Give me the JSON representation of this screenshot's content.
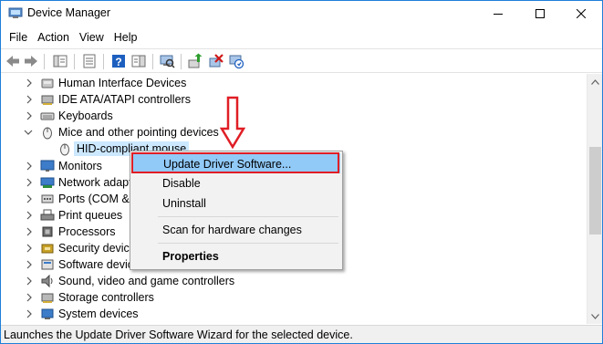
{
  "window": {
    "title": "Device Manager"
  },
  "menubar": [
    "File",
    "Action",
    "View",
    "Help"
  ],
  "tree": [
    {
      "label": "Human Interface Devices",
      "expanded": false,
      "icon": "hid-icon"
    },
    {
      "label": "IDE ATA/ATAPI controllers",
      "expanded": false,
      "icon": "ide-controller-icon"
    },
    {
      "label": "Keyboards",
      "expanded": false,
      "icon": "keyboard-icon"
    },
    {
      "label": "Mice and other pointing devices",
      "expanded": true,
      "icon": "mouse-icon"
    },
    {
      "label": "HID-compliant mouse",
      "child": true,
      "selected": true,
      "icon": "mouse-icon"
    },
    {
      "label": "Monitors",
      "expanded": false,
      "icon": "monitor-icon"
    },
    {
      "label": "Network adapt",
      "expanded": false,
      "icon": "network-adapter-icon"
    },
    {
      "label": "Ports (COM & ",
      "expanded": false,
      "icon": "port-icon"
    },
    {
      "label": "Print queues",
      "expanded": false,
      "icon": "printer-icon"
    },
    {
      "label": "Processors",
      "expanded": false,
      "icon": "processor-icon"
    },
    {
      "label": "Security device",
      "expanded": false,
      "icon": "security-device-icon"
    },
    {
      "label": "Software devic",
      "expanded": false,
      "icon": "software-device-icon"
    },
    {
      "label": "Sound, video and game controllers",
      "expanded": false,
      "icon": "sound-icon"
    },
    {
      "label": "Storage controllers",
      "expanded": false,
      "icon": "storage-controller-icon"
    },
    {
      "label": "System devices",
      "expanded": false,
      "icon": "system-device-icon"
    }
  ],
  "context_menu": {
    "update": "Update Driver Software...",
    "disable": "Disable",
    "uninstall": "Uninstall",
    "scan": "Scan for hardware changes",
    "properties": "Properties"
  },
  "status": "Launches the Update Driver Software Wizard for the selected device.",
  "colors": {
    "highlight": "#91c9f7",
    "selection": "#cce8ff",
    "annotation_red": "#e01e25"
  }
}
